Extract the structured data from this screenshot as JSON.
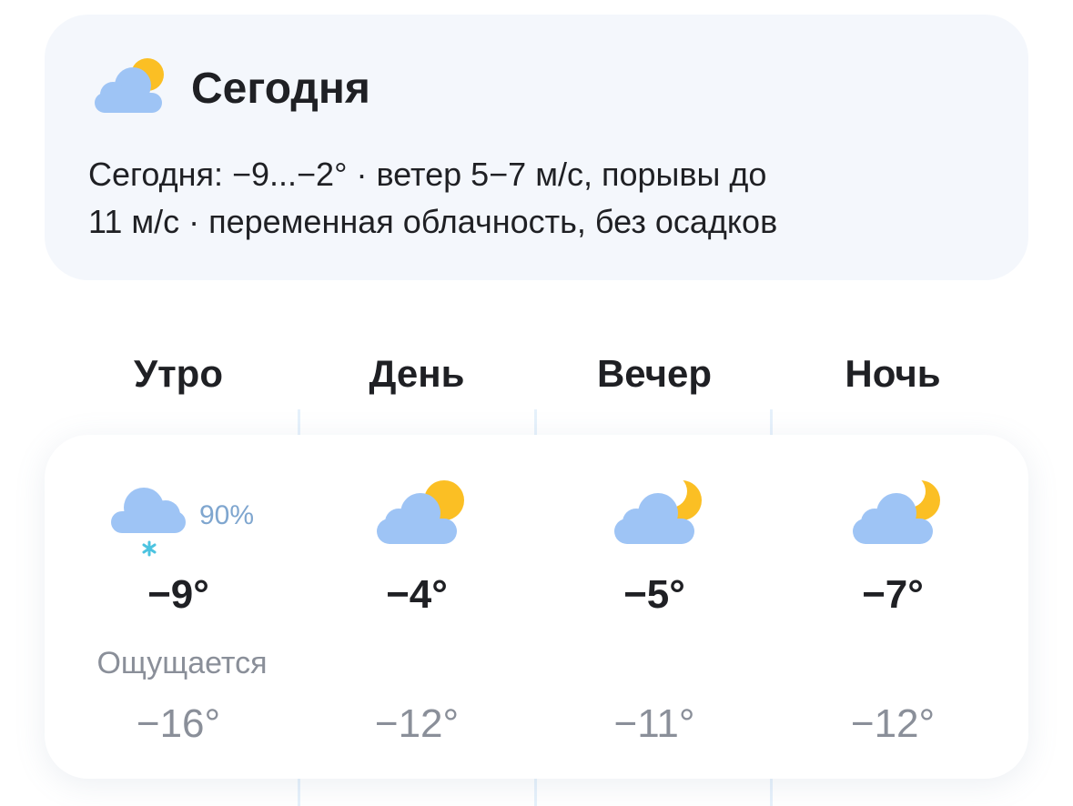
{
  "summary": {
    "icon": "partly-cloudy-day-icon",
    "title": "Сегодня",
    "text_line1": "Сегодня: −9...−2° · ветер 5−7 м/с, порывы до",
    "text_line2": "11 м/с · переменная облачность, без осадков"
  },
  "periods": [
    {
      "title": "Утро",
      "icon": "cloud-snow-icon",
      "precip": "90%",
      "temp": "−9°",
      "feels_label": "Ощущается",
      "feels": "−16°"
    },
    {
      "title": "День",
      "icon": "partly-cloudy-day-icon",
      "temp": "−4°",
      "feels": "−12°"
    },
    {
      "title": "Вечер",
      "icon": "partly-cloudy-night-icon",
      "temp": "−5°",
      "feels": "−11°"
    },
    {
      "title": "Ночь",
      "icon": "partly-cloudy-night-icon",
      "temp": "−7°",
      "feels": "−12°"
    }
  ],
  "colors": {
    "cloud": "#9ec4f5",
    "sun": "#fbbf24",
    "moon": "#fbbf24",
    "snow": "#4cc3e0",
    "precip_text": "#7fa6cf",
    "muted_text": "#8a8f99",
    "card_bg": "#f4f7fc"
  }
}
